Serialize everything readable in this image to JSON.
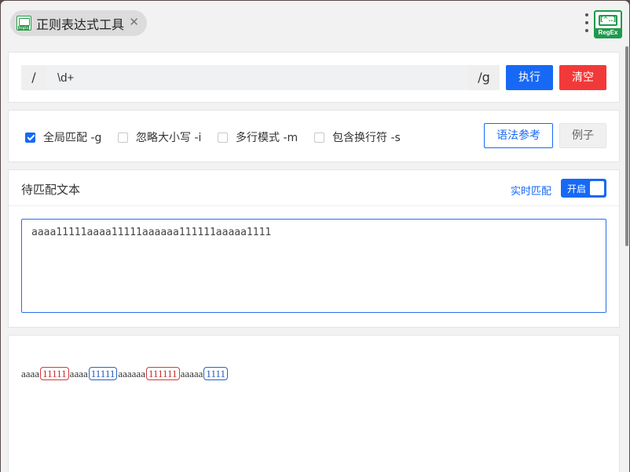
{
  "tab": {
    "title": "正则表达式工具",
    "close_glyph": "✕"
  },
  "logo": {
    "inner": "[^..]",
    "text": "RegEx"
  },
  "regex": {
    "prefix": "/",
    "pattern": "\\d+",
    "suffix": "/g",
    "execute_label": "执行",
    "clear_label": "清空"
  },
  "options": {
    "items": [
      {
        "label": "全局匹配 -g",
        "checked": true
      },
      {
        "label": "忽略大小写 -i",
        "checked": false
      },
      {
        "label": "多行模式 -m",
        "checked": false
      },
      {
        "label": "包含换行符 -s",
        "checked": false
      }
    ],
    "syntax_ref_label": "语法参考",
    "example_label": "例子"
  },
  "text_panel": {
    "title": "待匹配文本",
    "realtime_label": "实时匹配",
    "toggle_label": "开启",
    "toggle_on": true,
    "content": "aaaa11111aaaa11111aaaaaa111111aaaaa1111"
  },
  "result": {
    "segments": [
      {
        "text": "aaaa",
        "match": false
      },
      {
        "text": "11111",
        "match": true,
        "color": "red"
      },
      {
        "text": "aaaa",
        "match": false
      },
      {
        "text": "11111",
        "match": true,
        "color": "blue"
      },
      {
        "text": "aaaaaa",
        "match": false
      },
      {
        "text": "111111",
        "match": true,
        "color": "red"
      },
      {
        "text": "aaaaa",
        "match": false
      },
      {
        "text": "1111",
        "match": true,
        "color": "blue"
      }
    ]
  },
  "colors": {
    "primary": "#1769f5",
    "danger": "#f2393a",
    "match_red": "#c62c2c",
    "match_blue": "#1e56b8",
    "logo_green": "#1e9a4d"
  }
}
